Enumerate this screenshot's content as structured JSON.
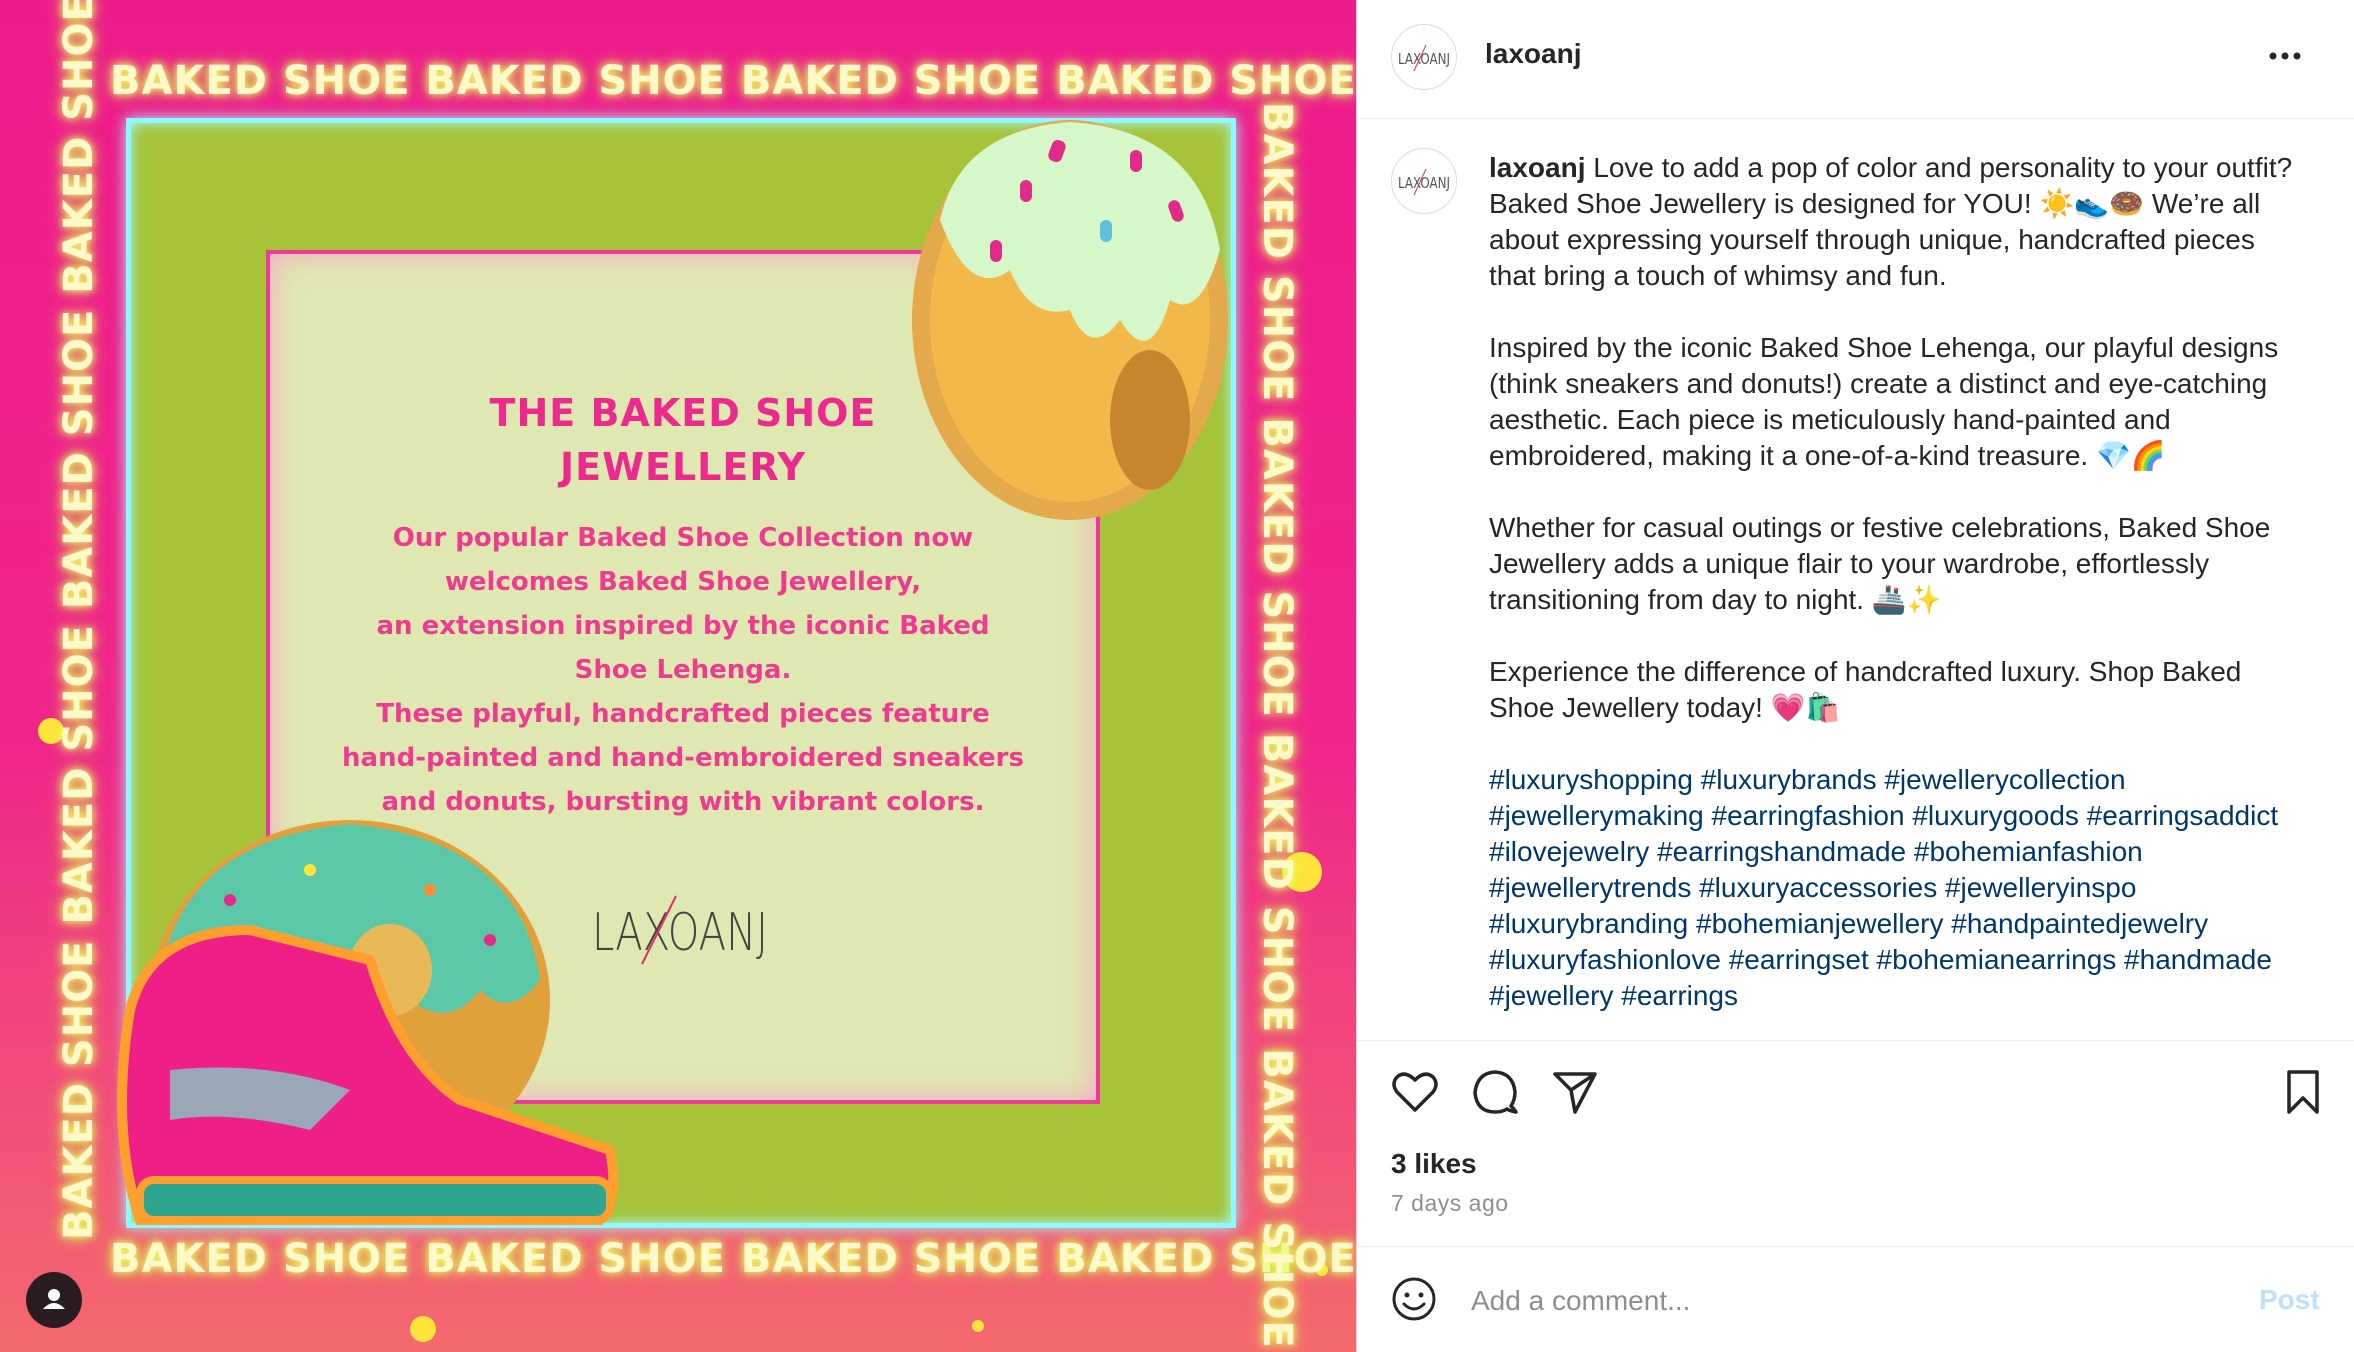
{
  "post": {
    "image": {
      "marquee_text": "BAKED SHOE BAKED SHOE BAKED SHOE BAKED SHOE",
      "card_title_line1": "THE BAKED SHOE",
      "card_title_line2": "JEWELLERY",
      "card_body_lines": [
        "Our popular Baked Shoe Collection now",
        "welcomes Baked Shoe Jewellery,",
        "an extension inspired by the iconic Baked",
        "Shoe Lehenga.",
        "These playful, handcrafted pieces feature",
        "hand-painted and hand-embroidered sneakers",
        "and donuts, bursting with vibrant colors."
      ],
      "logo_text": "LAXOANJ",
      "colors": {
        "background": "#ee1b8c",
        "green": "#a6c33a",
        "neon": "#8ff7ff",
        "card": "#dfe8b0",
        "pink_text": "#ec2a8d"
      }
    }
  },
  "header": {
    "username": "laxoanj",
    "avatar_text": "LAXOANJ"
  },
  "caption": {
    "username": "laxoanj",
    "paragraphs": [
      "Love to add a pop of color and personality to your outfit? Baked Shoe Jewellery is designed for YOU! ☀️👟🍩 We’re all about expressing yourself through unique, handcrafted pieces that bring a touch of whimsy and fun.",
      "Inspired by the iconic Baked Shoe Lehenga, our playful designs (think sneakers and donuts!) create a distinct and eye-catching aesthetic. Each piece is meticulously hand-painted and embroidered, making it a one-of-a-kind treasure. 💎🌈",
      "Whether for casual outings or festive celebrations, Baked Shoe Jewellery adds a unique flair to your wardrobe, effortlessly transitioning from day to night. 🚢✨",
      "Experience the difference of handcrafted luxury. Shop Baked Shoe Jewellery today! 💗🛍️"
    ],
    "hashtags": "#luxuryshopping #luxurybrands #jewellerycollection #jewellerymaking #earringfashion #luxurygoods #earringsaddict #ilovejewelry #earringshandmade #bohemianfashion #jewellerytrends #luxuryaccessories #jewelleryinspo #luxurybranding #bohemianjewellery #handpaintedjewelry #luxuryfashionlove #earringset #bohemianearrings #handmade #jewellery #earrings"
  },
  "actions": {
    "icons": [
      "heart-icon",
      "comment-icon",
      "share-icon",
      "bookmark-icon"
    ],
    "likes": "3 likes",
    "time_ago": "7 days ago"
  },
  "comment_box": {
    "placeholder": "Add a comment...",
    "post_label": "Post"
  }
}
